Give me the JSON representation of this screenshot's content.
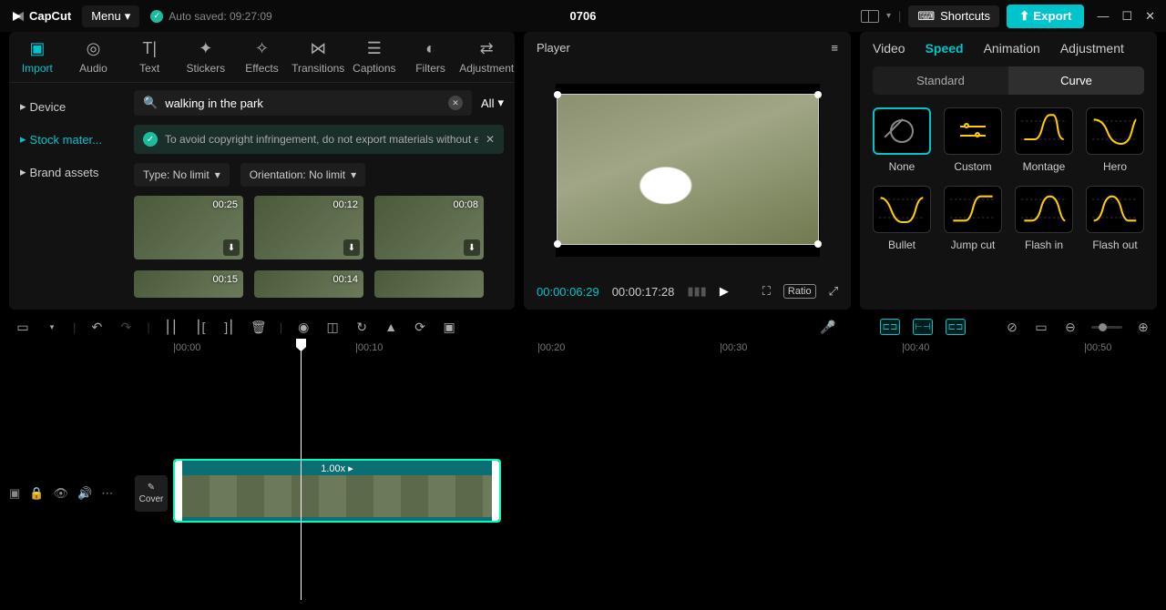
{
  "app": {
    "name": "CapCut"
  },
  "titlebar": {
    "menu": "Menu",
    "autosave": "Auto saved: 09:27:09",
    "project": "0706",
    "shortcuts": "Shortcuts",
    "export": "Export"
  },
  "media": {
    "tabs": [
      "Import",
      "Audio",
      "Text",
      "Stickers",
      "Effects",
      "Transitions",
      "Captions",
      "Filters",
      "Adjustment"
    ],
    "activeTab": "Import",
    "side": {
      "items": [
        "Device",
        "Stock mater...",
        "Brand assets"
      ],
      "active": "Stock mater..."
    },
    "search": {
      "value": "walking in the park",
      "all": "All"
    },
    "warning": "To avoid copyright infringement, do not export materials without e",
    "filters": {
      "type": "Type: No limit",
      "orient": "Orientation: No limit"
    },
    "thumbs": [
      {
        "dur": "00:25"
      },
      {
        "dur": "00:12"
      },
      {
        "dur": "00:08"
      },
      {
        "dur": "00:15"
      },
      {
        "dur": "00:14"
      },
      {
        "dur": ""
      }
    ]
  },
  "player": {
    "title": "Player",
    "current": "00:00:06:29",
    "total": "00:00:17:28",
    "ratio": "Ratio"
  },
  "inspector": {
    "tabs": [
      "Video",
      "Speed",
      "Animation",
      "Adjustment"
    ],
    "activeTab": "Speed",
    "segmented": {
      "standard": "Standard",
      "curve": "Curve",
      "active": "Curve"
    },
    "curves": [
      "None",
      "Custom",
      "Montage",
      "Hero",
      "Bullet",
      "Jump cut",
      "Flash in",
      "Flash out"
    ],
    "activeCurve": "None"
  },
  "ruler": {
    "marks": [
      "00:00",
      "00:10",
      "00:20",
      "00:30",
      "00:40",
      "00:50"
    ]
  },
  "timeline": {
    "clip": {
      "speed": "1.00x"
    },
    "cover": "Cover"
  }
}
